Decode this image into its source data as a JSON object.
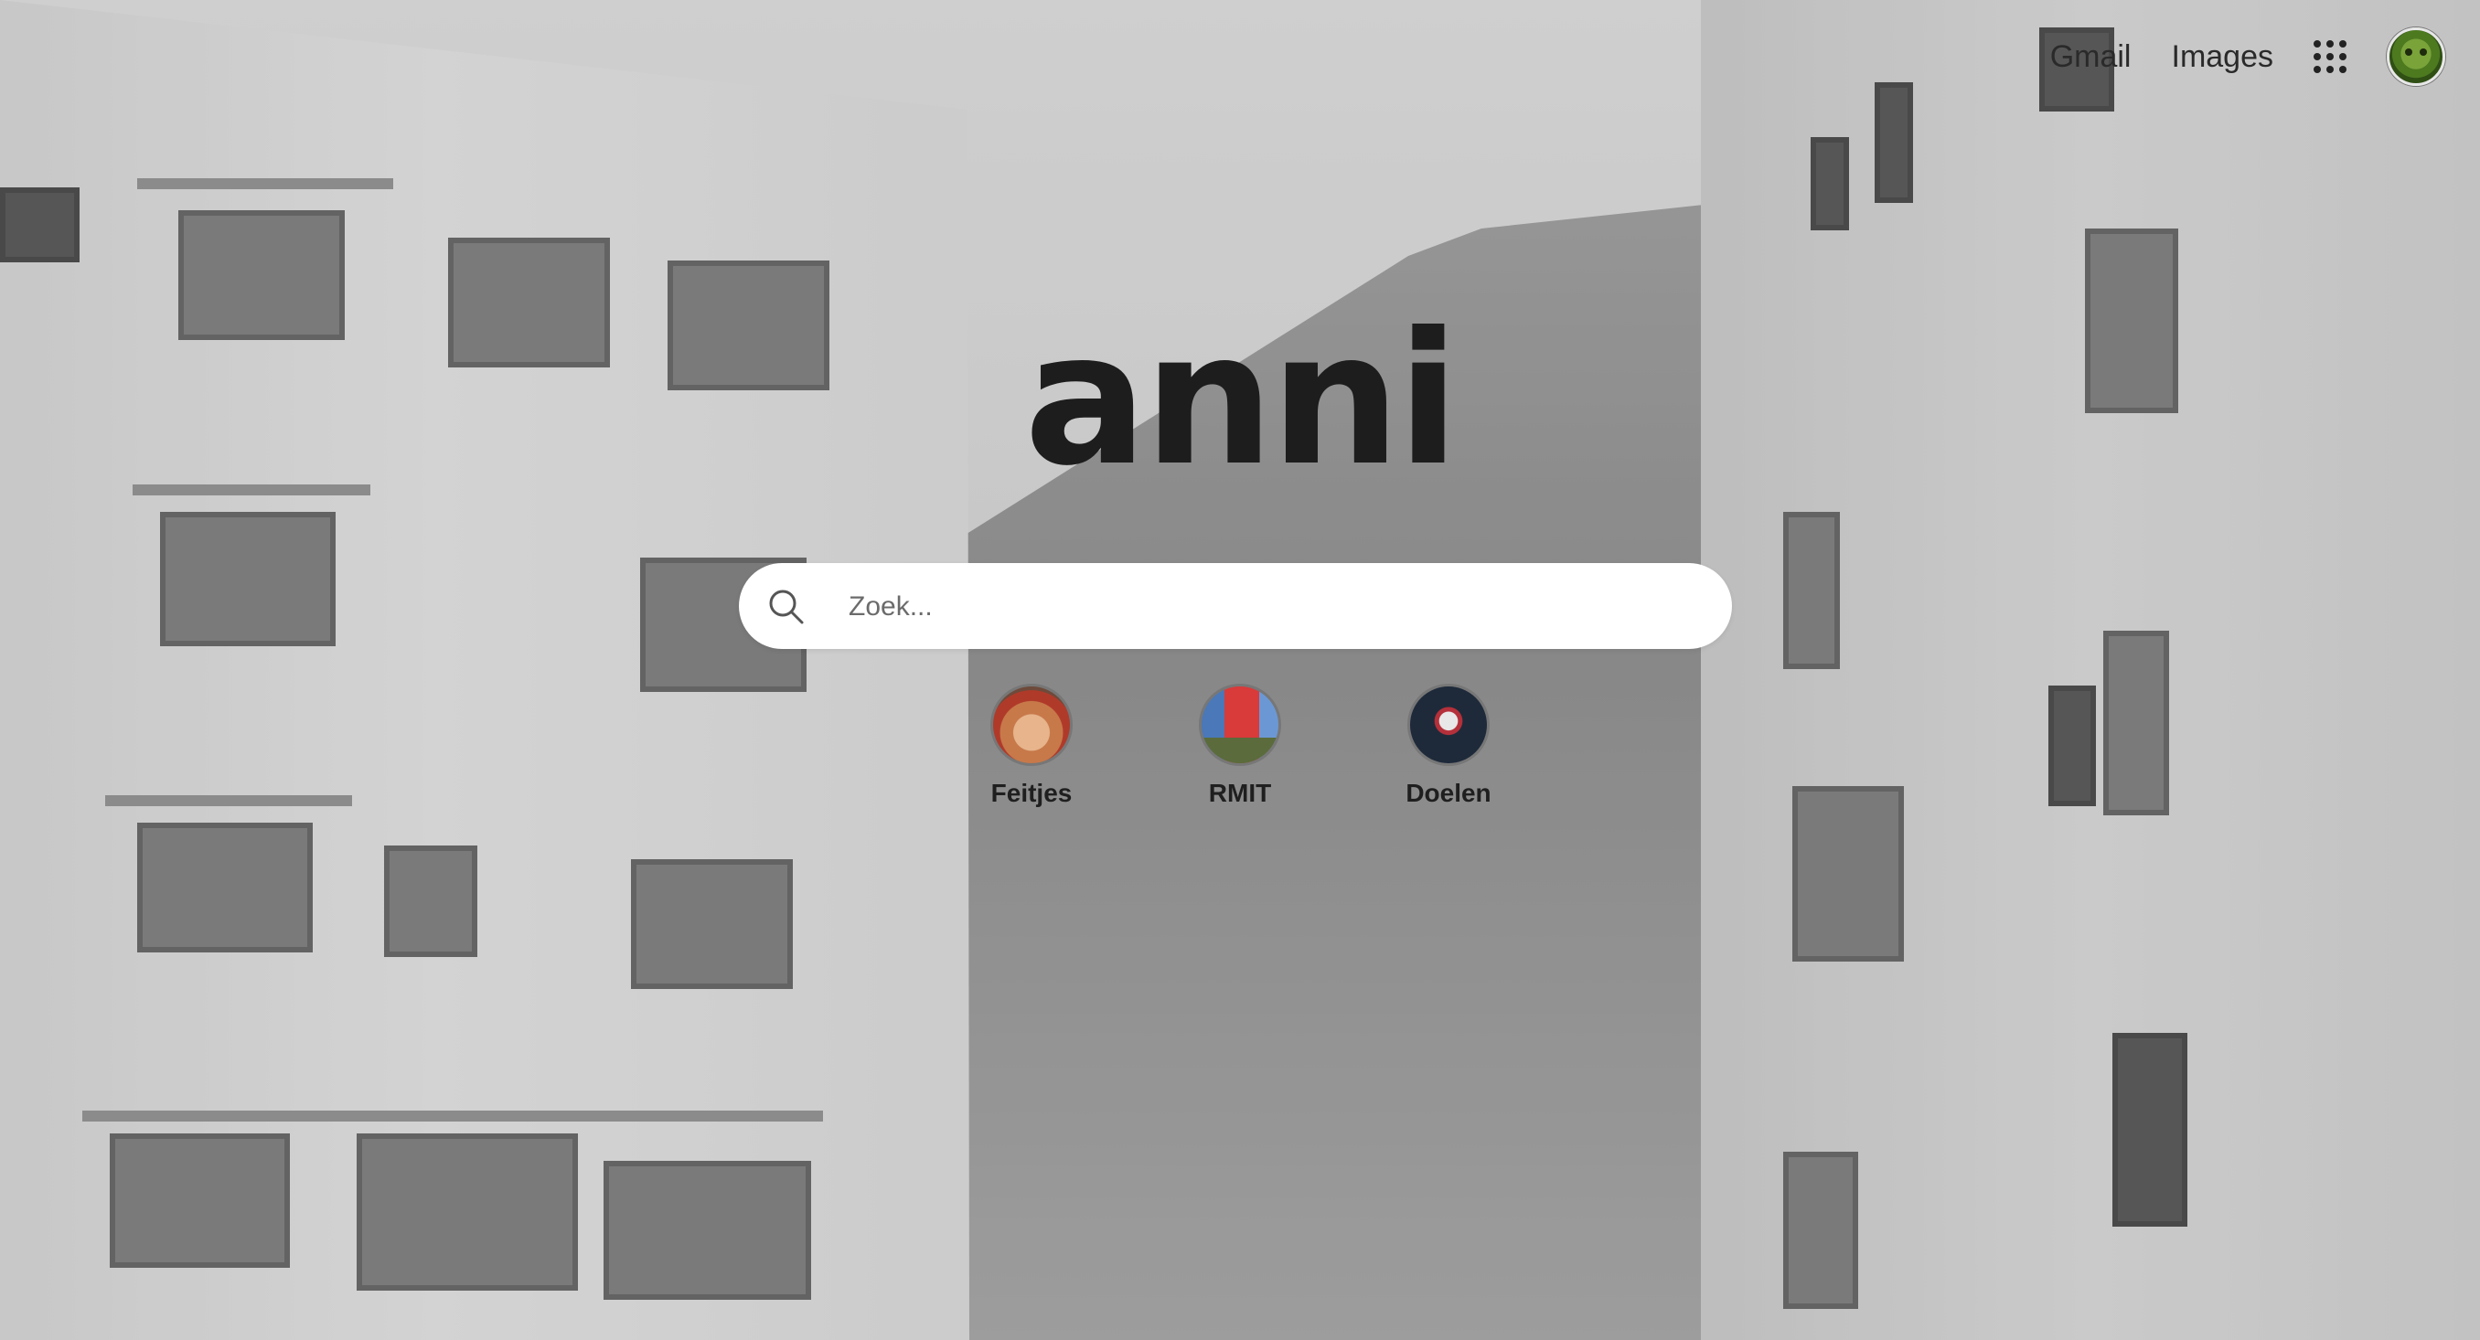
{
  "header": {
    "links": [
      {
        "label": "Gmail"
      },
      {
        "label": "Images"
      }
    ],
    "apps_icon": "apps-grid-icon",
    "avatar_icon": "user-avatar"
  },
  "logo": {
    "text": "anni"
  },
  "search": {
    "placeholder": "Zoek...",
    "value": "",
    "icon": "search-icon"
  },
  "shortcuts": [
    {
      "label": "Feitjes"
    },
    {
      "label": "RMIT"
    },
    {
      "label": "Doelen"
    }
  ],
  "colors": {
    "text": "#1d1d1d",
    "search_bg": "#ffffff"
  }
}
